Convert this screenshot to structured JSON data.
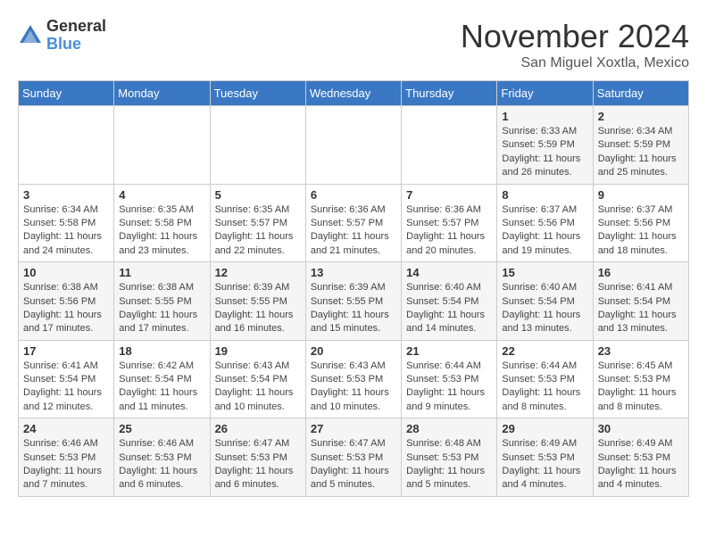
{
  "logo": {
    "general": "General",
    "blue": "Blue"
  },
  "title": "November 2024",
  "location": "San Miguel Xoxtla, Mexico",
  "days_header": [
    "Sunday",
    "Monday",
    "Tuesday",
    "Wednesday",
    "Thursday",
    "Friday",
    "Saturday"
  ],
  "weeks": [
    [
      {
        "day": "",
        "info": ""
      },
      {
        "day": "",
        "info": ""
      },
      {
        "day": "",
        "info": ""
      },
      {
        "day": "",
        "info": ""
      },
      {
        "day": "",
        "info": ""
      },
      {
        "day": "1",
        "info": "Sunrise: 6:33 AM\nSunset: 5:59 PM\nDaylight: 11 hours and 26 minutes."
      },
      {
        "day": "2",
        "info": "Sunrise: 6:34 AM\nSunset: 5:59 PM\nDaylight: 11 hours and 25 minutes."
      }
    ],
    [
      {
        "day": "3",
        "info": "Sunrise: 6:34 AM\nSunset: 5:58 PM\nDaylight: 11 hours and 24 minutes."
      },
      {
        "day": "4",
        "info": "Sunrise: 6:35 AM\nSunset: 5:58 PM\nDaylight: 11 hours and 23 minutes."
      },
      {
        "day": "5",
        "info": "Sunrise: 6:35 AM\nSunset: 5:57 PM\nDaylight: 11 hours and 22 minutes."
      },
      {
        "day": "6",
        "info": "Sunrise: 6:36 AM\nSunset: 5:57 PM\nDaylight: 11 hours and 21 minutes."
      },
      {
        "day": "7",
        "info": "Sunrise: 6:36 AM\nSunset: 5:57 PM\nDaylight: 11 hours and 20 minutes."
      },
      {
        "day": "8",
        "info": "Sunrise: 6:37 AM\nSunset: 5:56 PM\nDaylight: 11 hours and 19 minutes."
      },
      {
        "day": "9",
        "info": "Sunrise: 6:37 AM\nSunset: 5:56 PM\nDaylight: 11 hours and 18 minutes."
      }
    ],
    [
      {
        "day": "10",
        "info": "Sunrise: 6:38 AM\nSunset: 5:56 PM\nDaylight: 11 hours and 17 minutes."
      },
      {
        "day": "11",
        "info": "Sunrise: 6:38 AM\nSunset: 5:55 PM\nDaylight: 11 hours and 17 minutes."
      },
      {
        "day": "12",
        "info": "Sunrise: 6:39 AM\nSunset: 5:55 PM\nDaylight: 11 hours and 16 minutes."
      },
      {
        "day": "13",
        "info": "Sunrise: 6:39 AM\nSunset: 5:55 PM\nDaylight: 11 hours and 15 minutes."
      },
      {
        "day": "14",
        "info": "Sunrise: 6:40 AM\nSunset: 5:54 PM\nDaylight: 11 hours and 14 minutes."
      },
      {
        "day": "15",
        "info": "Sunrise: 6:40 AM\nSunset: 5:54 PM\nDaylight: 11 hours and 13 minutes."
      },
      {
        "day": "16",
        "info": "Sunrise: 6:41 AM\nSunset: 5:54 PM\nDaylight: 11 hours and 13 minutes."
      }
    ],
    [
      {
        "day": "17",
        "info": "Sunrise: 6:41 AM\nSunset: 5:54 PM\nDaylight: 11 hours and 12 minutes."
      },
      {
        "day": "18",
        "info": "Sunrise: 6:42 AM\nSunset: 5:54 PM\nDaylight: 11 hours and 11 minutes."
      },
      {
        "day": "19",
        "info": "Sunrise: 6:43 AM\nSunset: 5:54 PM\nDaylight: 11 hours and 10 minutes."
      },
      {
        "day": "20",
        "info": "Sunrise: 6:43 AM\nSunset: 5:53 PM\nDaylight: 11 hours and 10 minutes."
      },
      {
        "day": "21",
        "info": "Sunrise: 6:44 AM\nSunset: 5:53 PM\nDaylight: 11 hours and 9 minutes."
      },
      {
        "day": "22",
        "info": "Sunrise: 6:44 AM\nSunset: 5:53 PM\nDaylight: 11 hours and 8 minutes."
      },
      {
        "day": "23",
        "info": "Sunrise: 6:45 AM\nSunset: 5:53 PM\nDaylight: 11 hours and 8 minutes."
      }
    ],
    [
      {
        "day": "24",
        "info": "Sunrise: 6:46 AM\nSunset: 5:53 PM\nDaylight: 11 hours and 7 minutes."
      },
      {
        "day": "25",
        "info": "Sunrise: 6:46 AM\nSunset: 5:53 PM\nDaylight: 11 hours and 6 minutes."
      },
      {
        "day": "26",
        "info": "Sunrise: 6:47 AM\nSunset: 5:53 PM\nDaylight: 11 hours and 6 minutes."
      },
      {
        "day": "27",
        "info": "Sunrise: 6:47 AM\nSunset: 5:53 PM\nDaylight: 11 hours and 5 minutes."
      },
      {
        "day": "28",
        "info": "Sunrise: 6:48 AM\nSunset: 5:53 PM\nDaylight: 11 hours and 5 minutes."
      },
      {
        "day": "29",
        "info": "Sunrise: 6:49 AM\nSunset: 5:53 PM\nDaylight: 11 hours and 4 minutes."
      },
      {
        "day": "30",
        "info": "Sunrise: 6:49 AM\nSunset: 5:53 PM\nDaylight: 11 hours and 4 minutes."
      }
    ]
  ]
}
